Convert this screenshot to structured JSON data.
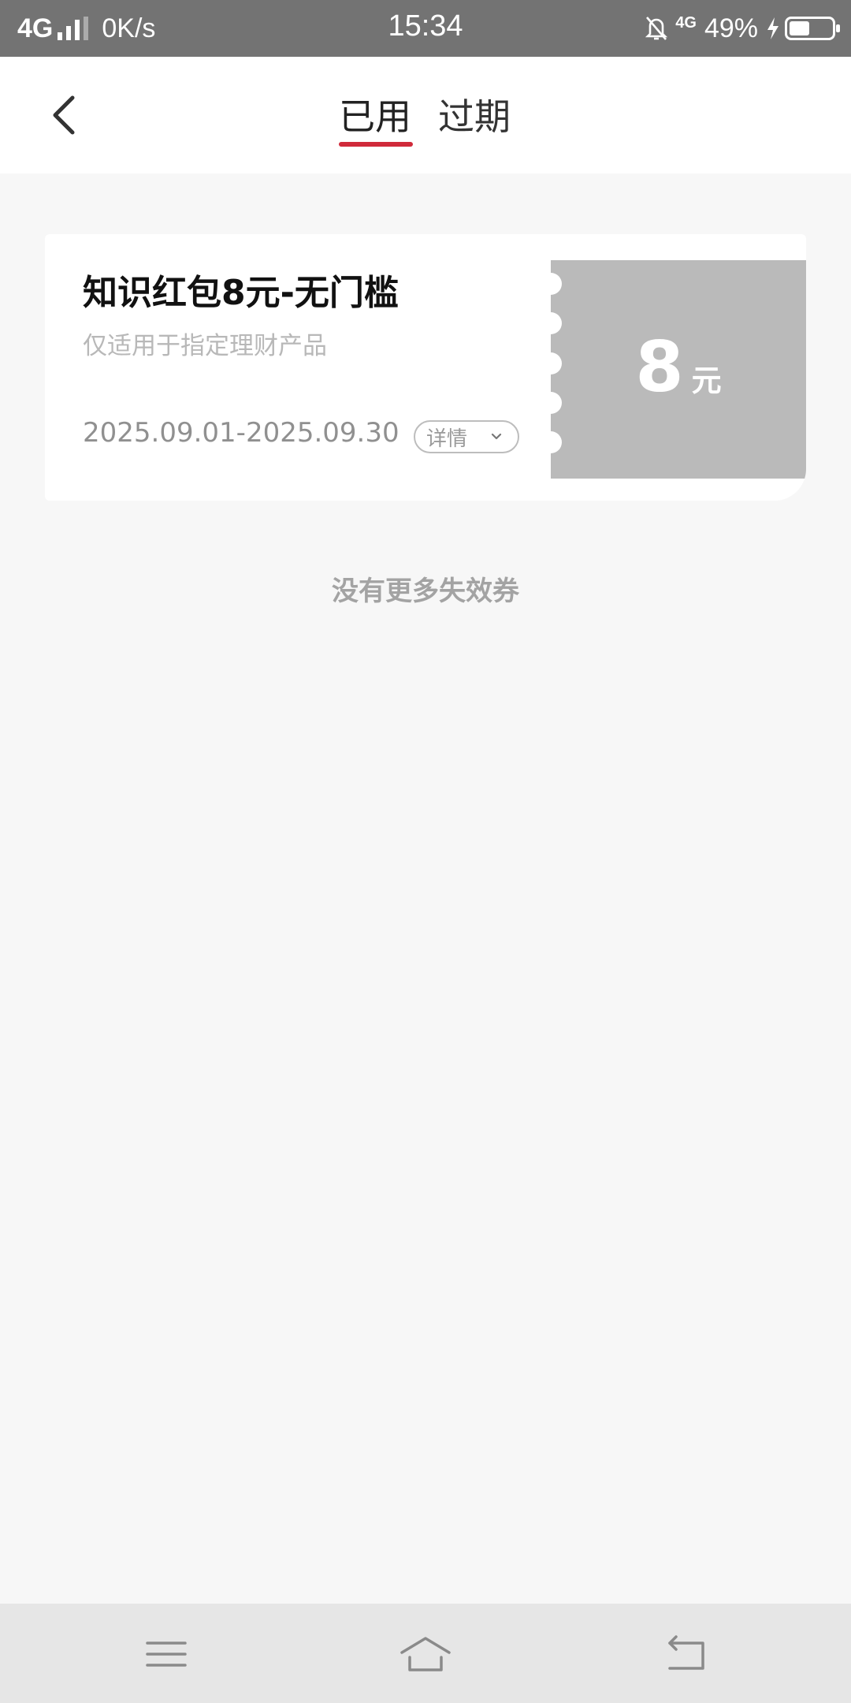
{
  "status_bar": {
    "network": "4G",
    "speed": "0K/s",
    "time": "15:34",
    "network2": "4G",
    "battery": "49%",
    "battery_level": 0.49,
    "icons": [
      "signal-icon",
      "bell-off-icon",
      "charging-icon",
      "battery-icon"
    ]
  },
  "header": {
    "back_icon": "chevron-left-icon",
    "tabs": [
      {
        "label": "已用",
        "active": true
      },
      {
        "label": "过期",
        "active": false
      }
    ],
    "accent_color": "#d02a3a"
  },
  "coupon": {
    "title": "知识红包8元-无门槛",
    "subtitle": "仅适用于指定理财产品",
    "validity": "2025.09.01-2025.09.30",
    "detail_label": "详情",
    "detail_icon": "chevron-down-icon",
    "amount": "8",
    "unit": "元",
    "stub_color": "#bababa"
  },
  "footer_note": "没有更多失效券",
  "nav_bar": {
    "icons": [
      "menu-icon",
      "home-icon",
      "back-icon"
    ]
  }
}
